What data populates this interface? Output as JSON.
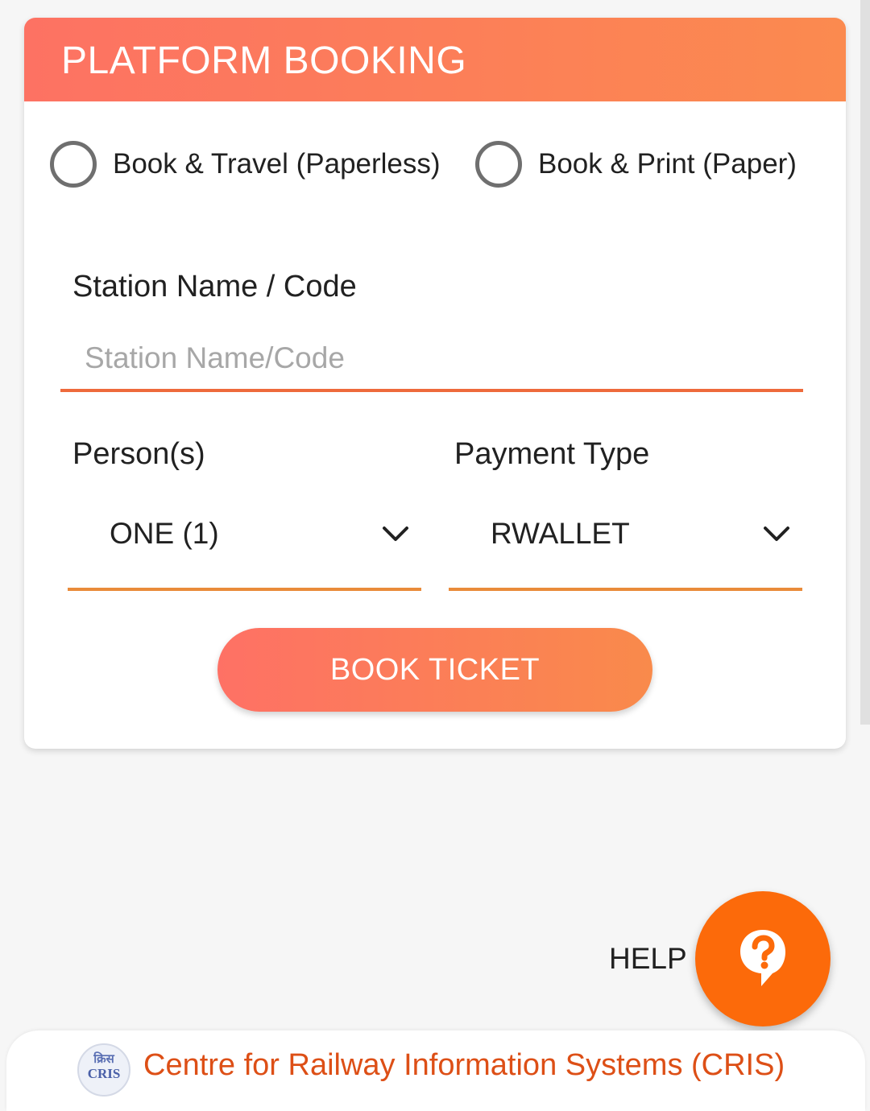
{
  "card": {
    "title": "PLATFORM BOOKING",
    "header_gradient": [
      "#fd7263",
      "#fb8a4f"
    ]
  },
  "booking_mode": {
    "options": [
      {
        "label": "Book & Travel (Paperless)",
        "selected": false
      },
      {
        "label": "Book & Print (Paper)",
        "selected": false
      }
    ]
  },
  "station": {
    "label": "Station Name / Code",
    "placeholder": "Station Name/Code",
    "value": ""
  },
  "persons": {
    "label": "Person(s)",
    "selected": "ONE (1)"
  },
  "payment": {
    "label": "Payment Type",
    "selected": "RWALLET"
  },
  "book_button": {
    "label": "BOOK TICKET"
  },
  "help": {
    "label": "HELP",
    "icon": "help-bubble-icon",
    "color": "#fc6a0a"
  },
  "footer": {
    "logo_top": "क्रिस",
    "logo_bottom": "CRIS",
    "text": "Centre for Railway Information Systems (CRIS)",
    "text_color": "#dd4f16"
  }
}
